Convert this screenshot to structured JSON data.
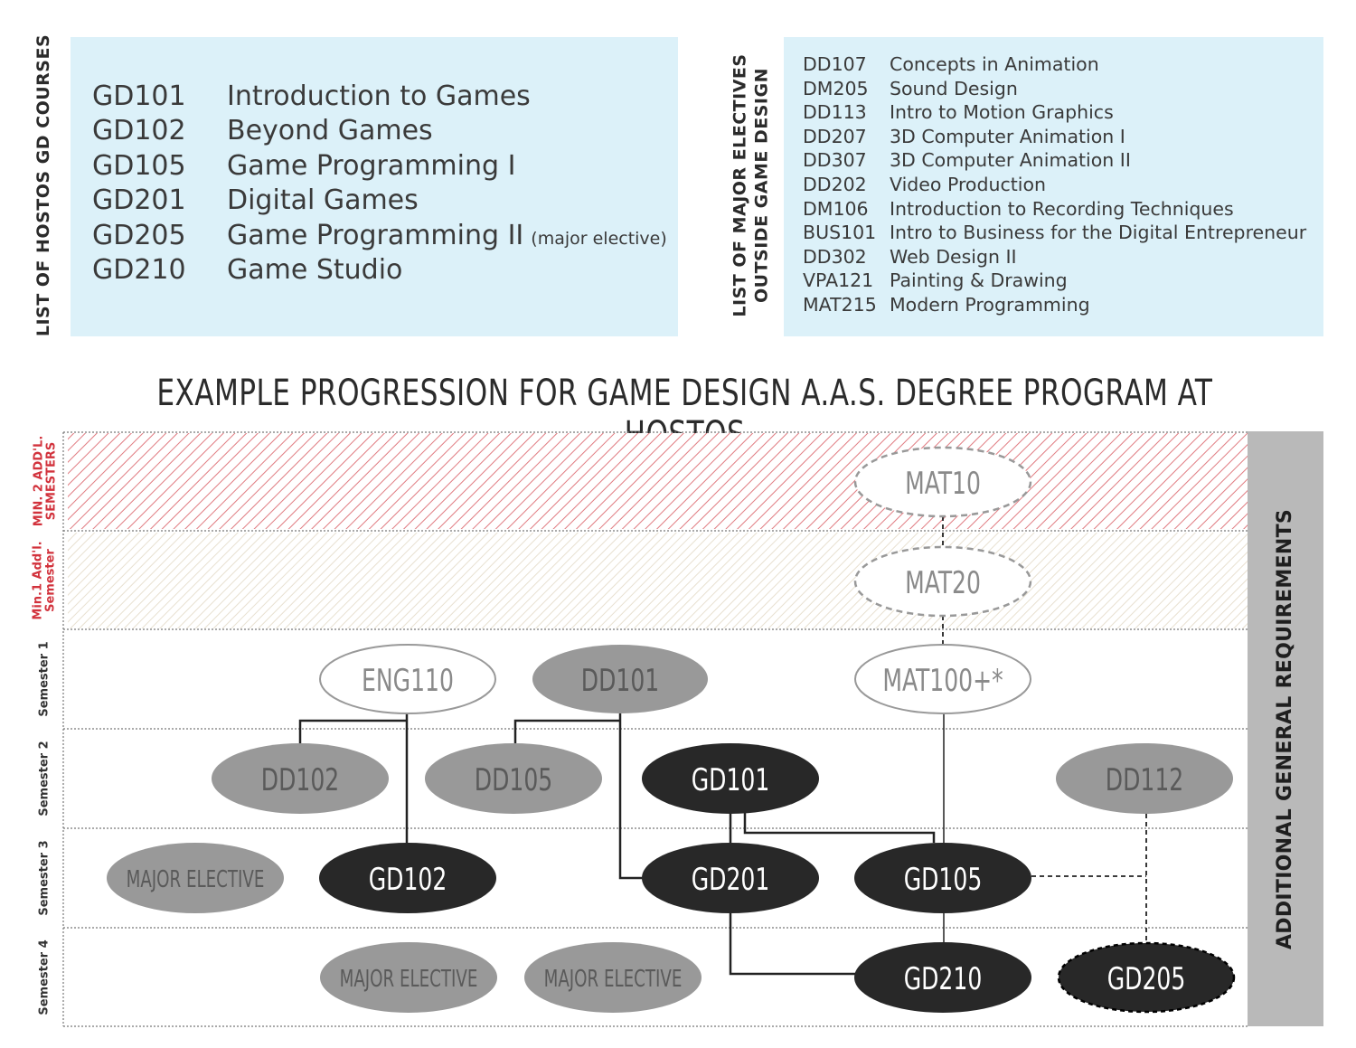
{
  "gd_courses": {
    "heading": "LIST OF HOSTOS GD COURSES",
    "items": [
      {
        "code": "GD101",
        "name": "Introduction to Games",
        "note": ""
      },
      {
        "code": "GD102",
        "name": "Beyond Games",
        "note": ""
      },
      {
        "code": "GD105",
        "name": "Game Programming I",
        "note": ""
      },
      {
        "code": "GD201",
        "name": "Digital Games",
        "note": ""
      },
      {
        "code": "GD205",
        "name": "Game Programming II",
        "note": "(major elective)"
      },
      {
        "code": "GD210",
        "name": "Game Studio",
        "note": ""
      }
    ]
  },
  "electives": {
    "heading_line1": "LIST OF MAJOR ELECTIVES",
    "heading_line2": "OUTSIDE GAME DESIGN",
    "items": [
      {
        "code": "DD107",
        "name": "Concepts in Animation"
      },
      {
        "code": "DM205",
        "name": "Sound Design"
      },
      {
        "code": "DD113",
        "name": "Intro to Motion Graphics"
      },
      {
        "code": "DD207",
        "name": "3D Computer Animation I"
      },
      {
        "code": "DD307",
        "name": "3D Computer Animation II"
      },
      {
        "code": "DD202",
        "name": "Video Production"
      },
      {
        "code": "DM106",
        "name": "Introduction to Recording Techniques"
      },
      {
        "code": "BUS101",
        "name": "Intro to Business for the Digital Entrepreneur"
      },
      {
        "code": "DD302",
        "name": "Web Design II"
      },
      {
        "code": "VPA121",
        "name": "Painting & Drawing"
      },
      {
        "code": "MAT215",
        "name": "Modern Programming"
      }
    ]
  },
  "progression": {
    "title": "EXAMPLE PROGRESSION FOR GAME DESIGN A.A.S. DEGREE PROGRAM AT HOSTOS",
    "side_label": "ADDITIONAL GENERAL REQUIREMENTS",
    "rows": [
      {
        "line1": "MIN. 2 ADD'L.",
        "line2": "SEMESTERS",
        "color": "#d2323c"
      },
      {
        "line1": "Min.1 Add'l.",
        "line2": "Semester",
        "color": "#d2323c"
      },
      {
        "line1": "Semester 1",
        "line2": "",
        "color": "#1f1f1f"
      },
      {
        "line1": "Semester 2",
        "line2": "",
        "color": "#1f1f1f"
      },
      {
        "line1": "Semester 3",
        "line2": "",
        "color": "#1f1f1f"
      },
      {
        "line1": "Semester 4",
        "line2": "",
        "color": "#1f1f1f"
      }
    ],
    "nodes": [
      {
        "id": "mat10",
        "label": "MAT10",
        "style": "dashed-outline"
      },
      {
        "id": "mat20",
        "label": "MAT20",
        "style": "dashed-outline"
      },
      {
        "id": "eng110",
        "label": "ENG110",
        "style": "outline"
      },
      {
        "id": "dd101",
        "label": "DD101",
        "style": "gray"
      },
      {
        "id": "mat100",
        "label": "MAT100+*",
        "style": "outline"
      },
      {
        "id": "dd102",
        "label": "DD102",
        "style": "gray"
      },
      {
        "id": "dd105",
        "label": "DD105",
        "style": "gray"
      },
      {
        "id": "gd101",
        "label": "GD101",
        "style": "black"
      },
      {
        "id": "dd112",
        "label": "DD112",
        "style": "gray"
      },
      {
        "id": "elective3",
        "label": "MAJOR ELECTIVE",
        "style": "gray"
      },
      {
        "id": "gd102",
        "label": "GD102",
        "style": "black"
      },
      {
        "id": "gd201",
        "label": "GD201",
        "style": "black"
      },
      {
        "id": "gd105",
        "label": "GD105",
        "style": "black"
      },
      {
        "id": "elective4a",
        "label": "MAJOR ELECTIVE",
        "style": "gray"
      },
      {
        "id": "elective4b",
        "label": "MAJOR ELECTIVE",
        "style": "gray"
      },
      {
        "id": "gd210",
        "label": "GD210",
        "style": "black"
      },
      {
        "id": "gd205",
        "label": "GD205",
        "style": "black-dashed"
      }
    ],
    "colors": {
      "black_node": "#282828",
      "gray_node": "#999999",
      "gray_text": "#5a5a5a",
      "outline_text": "#8a8a8a",
      "hatch_red": "#e07a80",
      "hatch_light": "#e8e0d0",
      "panel_blue": "#dcf1f9",
      "side_gray": "#b9b9b9"
    }
  }
}
